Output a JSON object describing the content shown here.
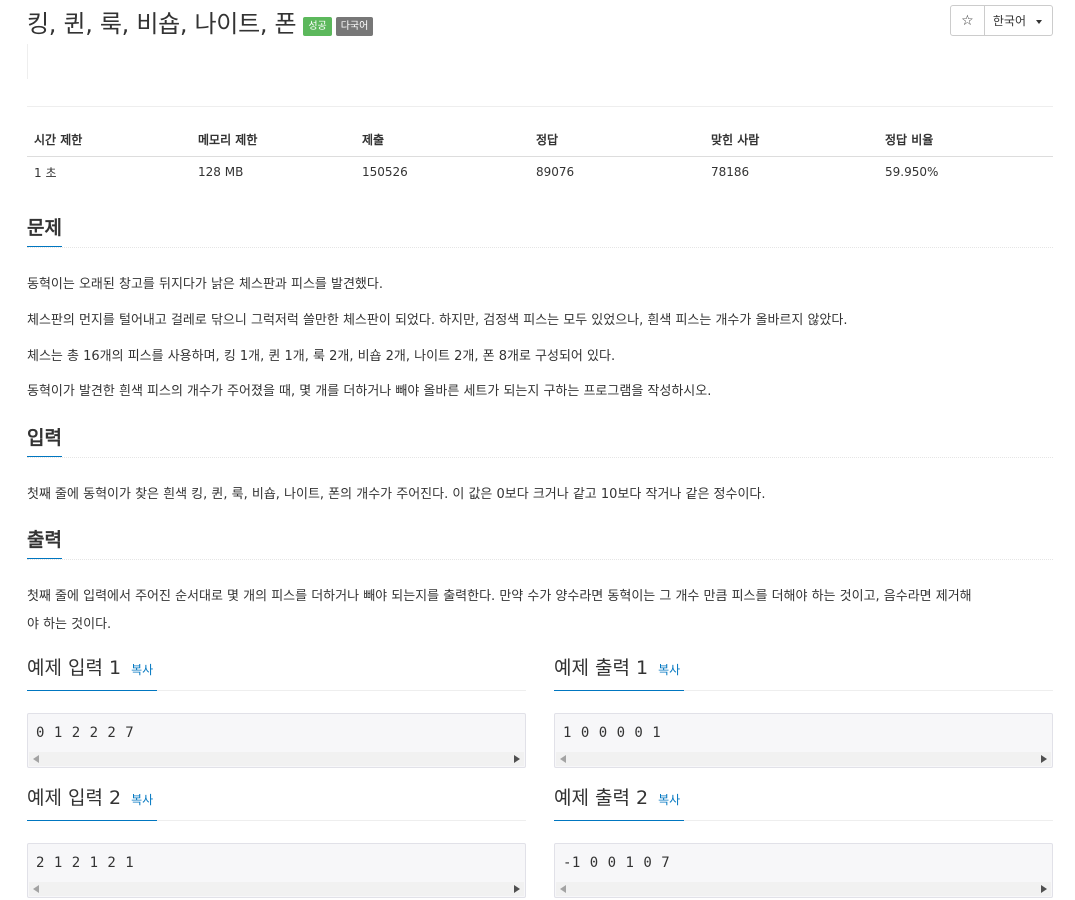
{
  "header": {
    "title": "킹, 퀸, 룩, 비숍, 나이트, 폰",
    "badge_success": "성공",
    "badge_multilang": "다국어",
    "star_icon": "☆",
    "language": "한국어"
  },
  "info": {
    "columns": [
      "시간 제한",
      "메모리 제한",
      "제출",
      "정답",
      "맞힌 사람",
      "정답 비율"
    ],
    "values": [
      "1 초",
      "128 MB",
      "150526",
      "89076",
      "78186",
      "59.950%"
    ]
  },
  "problem": {
    "title": "문제",
    "paragraphs": [
      "동혁이는 오래된 창고를 뒤지다가 낡은 체스판과 피스를 발견했다.",
      "체스판의 먼지를 털어내고 걸레로 닦으니 그럭저럭 쓸만한 체스판이 되었다. 하지만, 검정색 피스는 모두 있었으나, 흰색 피스는 개수가 올바르지 않았다.",
      "체스는 총 16개의 피스를 사용하며, 킹 1개, 퀸 1개, 룩 2개, 비숍 2개, 나이트 2개, 폰 8개로 구성되어 있다.",
      "동혁이가 발견한 흰색 피스의 개수가 주어졌을 때, 몇 개를 더하거나 빼야 올바른 세트가 되는지 구하는 프로그램을 작성하시오."
    ]
  },
  "input": {
    "title": "입력",
    "text": "첫째 줄에 동혁이가 찾은 흰색 킹, 퀸, 룩, 비숍, 나이트, 폰의 개수가 주어진다. 이 값은 0보다 크거나 같고 10보다 작거나 같은 정수이다."
  },
  "output": {
    "title": "출력",
    "line1": "첫째 줄에 입력에서 주어진 순서대로 몇 개의 피스를 더하거나 빼야 되는지를 출력한다. 만약 수가 양수라면 동혁이는 그 개수 만큼 피스를 더해야 하는 것이고, 음수라면 제거해",
    "line2": "야 하는 것이다."
  },
  "samples": {
    "copy_label": "복사",
    "input1_title": "예제 입력 1",
    "input1_data": "0 1 2 2 2 7",
    "output1_title": "예제 출력 1",
    "output1_data": "1 0 0 0 0 1",
    "input2_title": "예제 입력 2",
    "input2_data": "2 1 2 1 2 1",
    "output2_title": "예제 출력 2",
    "output2_data": "-1 0 0 1 0 7"
  }
}
